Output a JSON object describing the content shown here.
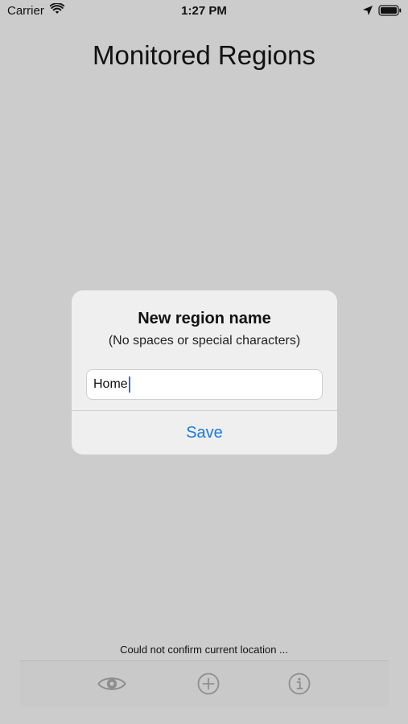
{
  "status_bar": {
    "carrier": "Carrier",
    "time": "1:27 PM",
    "icons": [
      "wifi-icon",
      "location-arrow-icon",
      "battery-icon"
    ]
  },
  "page": {
    "title": "Monitored Regions"
  },
  "alert": {
    "title": "New region name",
    "message": "(No spaces or special characters)",
    "input_value": "Home",
    "action_label": "Save"
  },
  "footer": {
    "status_message": "Could not confirm current location ..."
  },
  "toolbar": {
    "items": [
      {
        "icon": "eye-icon"
      },
      {
        "icon": "add-circle-icon"
      },
      {
        "icon": "info-icon"
      }
    ]
  },
  "colors": {
    "background": "#cccccc",
    "alert_background": "#efefef",
    "action_blue": "#1a7ae0",
    "toolbar_icon_gray": "#8e8e8e"
  }
}
